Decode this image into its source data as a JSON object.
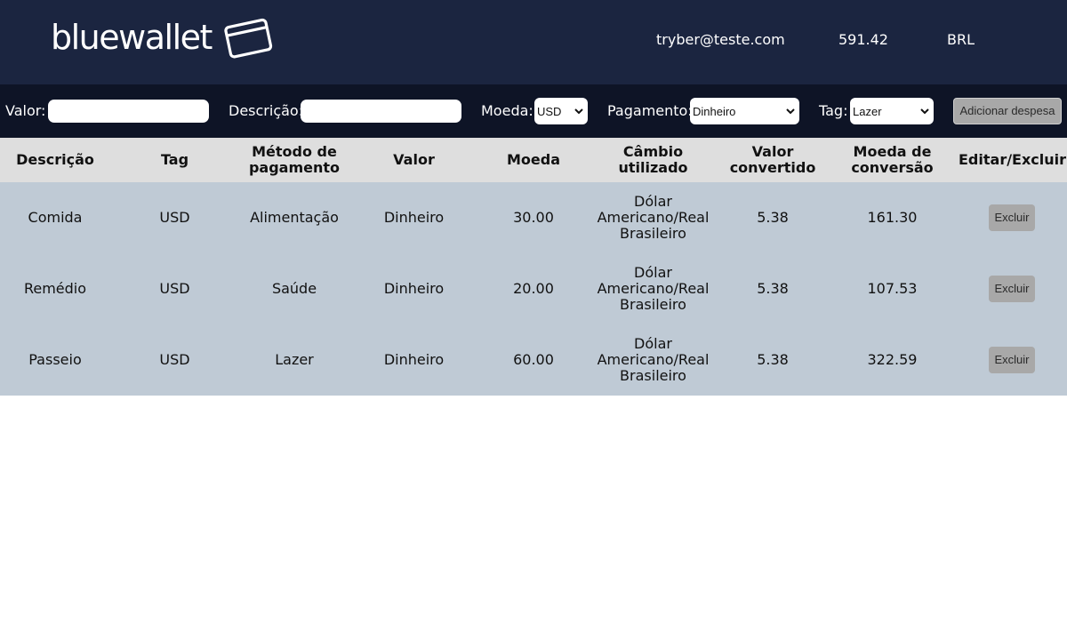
{
  "header": {
    "logo_text": "bluewallet",
    "logo_icon": "wallet-icon",
    "email": "tryber@teste.com",
    "total": "591.42",
    "currency": "BRL"
  },
  "form": {
    "valor_label": "Valor:",
    "valor_value": "",
    "descricao_label": "Descrição:",
    "descricao_value": "",
    "moeda_label": "Moeda:",
    "moeda_selected": "USD",
    "pagamento_label": "Pagamento:",
    "pagamento_selected": "Dinheiro",
    "tag_label": "Tag:",
    "tag_selected": "Lazer",
    "add_button": "Adicionar despesa"
  },
  "table": {
    "headers": [
      "Descrição",
      "Tag",
      "Método de pagamento",
      "Valor",
      "Moeda",
      "Câmbio utilizado",
      "Valor convertido",
      "Moeda de conversão",
      "Editar/Excluir"
    ],
    "rows": [
      [
        "Comida",
        "USD",
        "Alimentação",
        "Dinheiro",
        "30.00",
        "Dólar Americano/Real Brasileiro",
        "5.38",
        "161.30",
        "Excluir"
      ],
      [
        "Remédio",
        "USD",
        "Saúde",
        "Dinheiro",
        "20.00",
        "Dólar Americano/Real Brasileiro",
        "5.38",
        "107.53",
        "Excluir"
      ],
      [
        "Passeio",
        "USD",
        "Lazer",
        "Dinheiro",
        "60.00",
        "Dólar Americano/Real Brasileiro",
        "5.38",
        "322.59",
        "Excluir"
      ]
    ]
  }
}
